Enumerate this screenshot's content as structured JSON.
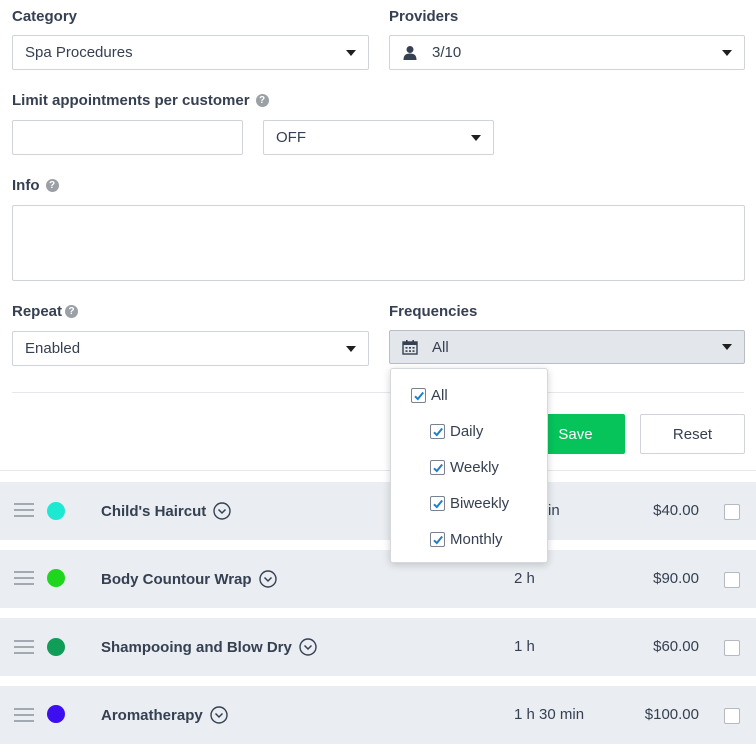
{
  "category": {
    "label": "Category",
    "value": "Spa Procedures"
  },
  "providers": {
    "label": "Providers",
    "value": "3/10"
  },
  "limit": {
    "label": "Limit appointments per customer",
    "input_value": "",
    "select_value": "OFF"
  },
  "info": {
    "label": "Info",
    "value": ""
  },
  "repeat": {
    "label": "Repeat",
    "value": "Enabled"
  },
  "frequencies": {
    "label": "Frequencies",
    "value": "All",
    "options": [
      {
        "label": "All",
        "checked": true
      },
      {
        "label": "Daily",
        "checked": true
      },
      {
        "label": "Weekly",
        "checked": true
      },
      {
        "label": "Biweekly",
        "checked": true
      },
      {
        "label": "Monthly",
        "checked": true
      }
    ]
  },
  "buttons": {
    "save": "Save",
    "reset": "Reset"
  },
  "help_glyph": "?",
  "services": [
    {
      "name": "Child's Haircut",
      "duration": "in",
      "price": "$40.00",
      "color": "#1de9d2"
    },
    {
      "name": "Body Countour Wrap",
      "duration": "2 h",
      "price": "$90.00",
      "color": "#1ed61e"
    },
    {
      "name": "Shampooing and Blow Dry",
      "duration": "1 h",
      "price": "$60.00",
      "color": "#0f9d58"
    },
    {
      "name": "Aromatherapy",
      "duration": "1 h 30 min",
      "price": "$100.00",
      "color": "#3d0ff0"
    }
  ]
}
